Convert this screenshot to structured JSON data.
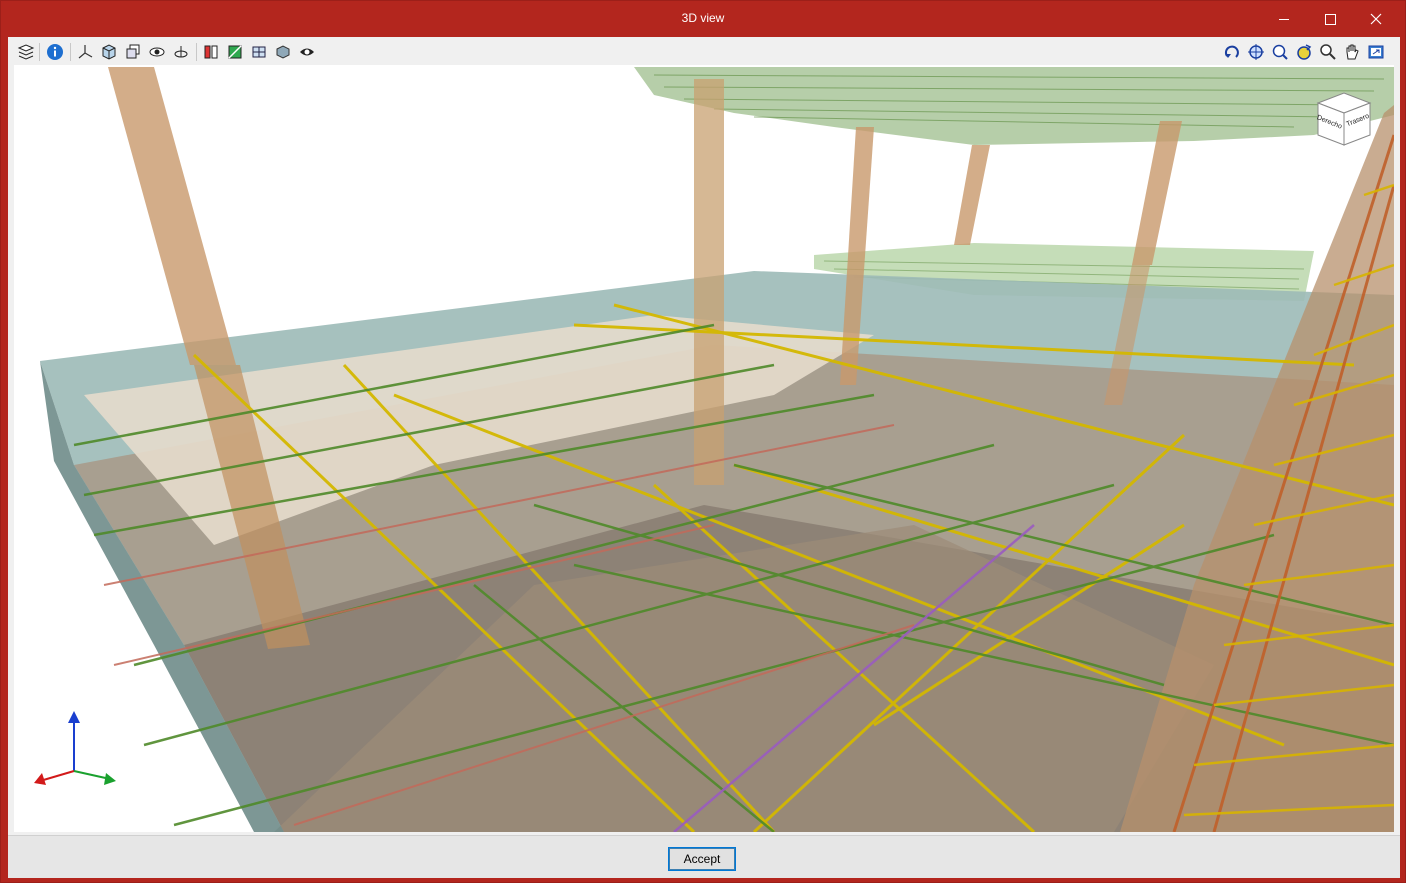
{
  "window": {
    "title": "3D view",
    "accent_color": "#b3261e"
  },
  "toolbar": {
    "left_tools": [
      {
        "icon": "layers-icon"
      },
      {
        "icon": "info-icon"
      },
      {
        "icon": "axes-icon"
      },
      {
        "icon": "view-cube-icon"
      },
      {
        "icon": "multi-view-icon"
      },
      {
        "icon": "visibility-icon"
      },
      {
        "icon": "rotate-axis-icon"
      },
      {
        "icon": "section-icon"
      },
      {
        "icon": "render-mode-icon"
      },
      {
        "icon": "grid-icon"
      },
      {
        "icon": "solid-icon"
      },
      {
        "icon": "eye-icon"
      }
    ],
    "right_tools": [
      {
        "icon": "rotate-view-icon"
      },
      {
        "icon": "zoom-all-icon"
      },
      {
        "icon": "zoom-window-icon"
      },
      {
        "icon": "refresh-view-icon"
      },
      {
        "icon": "zoom-icon"
      },
      {
        "icon": "pan-hand-icon"
      },
      {
        "icon": "export-view-icon"
      }
    ]
  },
  "view_cube": {
    "front_label": "Derecho",
    "side_label": "Trasero"
  },
  "footer": {
    "accept_label": "Accept"
  }
}
